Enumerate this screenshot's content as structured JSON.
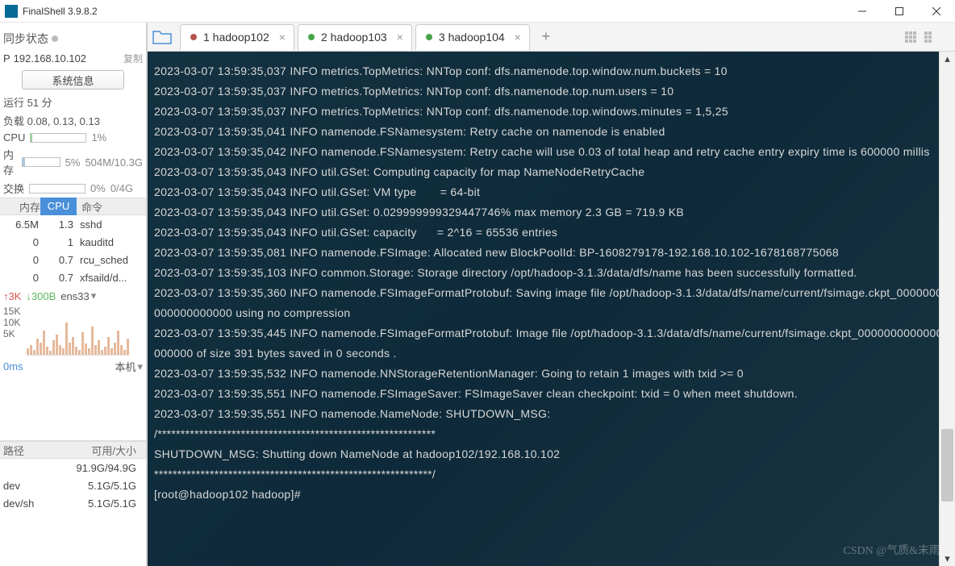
{
  "title": "FinalShell 3.9.8.2",
  "sidebar": {
    "sync_label": "同步状态",
    "ip_prefix": "P",
    "ip": "192.168.10.102",
    "copy": "复制",
    "sysinfo_btn": "系统信息",
    "uptime": "运行 51 分",
    "load": "负载 0.08, 0.13, 0.13",
    "cpu_label": "CPU",
    "cpu_val": "1%",
    "mem_label": "内存",
    "mem_pct": "5%",
    "mem_val": "504M/10.3G",
    "swap_label": "交换",
    "swap_pct": "0%",
    "swap_val": "0/4G",
    "proc_head": {
      "mem": "内存",
      "cpu": "CPU",
      "cmd": "命令"
    },
    "procs": [
      {
        "mem": "6.5M",
        "cpu": "1.3",
        "cmd": "sshd"
      },
      {
        "mem": "0",
        "cpu": "1",
        "cmd": "kauditd"
      },
      {
        "mem": "0",
        "cpu": "0.7",
        "cmd": "rcu_sched"
      },
      {
        "mem": "0",
        "cpu": "0.7",
        "cmd": "xfsaild/d..."
      }
    ],
    "net_up": "↑3K",
    "net_down": "↓300B",
    "net_if": "ens33",
    "net_labels": [
      "15K",
      "10K",
      "5K"
    ],
    "host_left": "0ms",
    "host_right": "本机",
    "disk_head": {
      "path": "路径",
      "size": "可用/大小"
    },
    "disks": [
      {
        "path": "",
        "size": "91.9G/94.9G"
      },
      {
        "path": "dev",
        "size": "5.1G/5.1G"
      },
      {
        "path": "dev/sh",
        "size": "5.1G/5.1G"
      }
    ]
  },
  "tabs": [
    {
      "label": "1 hadoop102",
      "active": true,
      "dot": "red"
    },
    {
      "label": "2 hadoop103",
      "active": false,
      "dot": "green"
    },
    {
      "label": "3 hadoop104",
      "active": false,
      "dot": "green"
    }
  ],
  "terminal": [
    "2023-03-07 13:59:35,037 INFO metrics.TopMetrics: NNTop conf: dfs.namenode.top.window.num.buckets = 10",
    "2023-03-07 13:59:35,037 INFO metrics.TopMetrics: NNTop conf: dfs.namenode.top.num.users = 10",
    "2023-03-07 13:59:35,037 INFO metrics.TopMetrics: NNTop conf: dfs.namenode.top.windows.minutes = 1,5,25",
    "2023-03-07 13:59:35,041 INFO namenode.FSNamesystem: Retry cache on namenode is enabled",
    "2023-03-07 13:59:35,042 INFO namenode.FSNamesystem: Retry cache will use 0.03 of total heap and retry cache entry expiry time is 600000 millis",
    "2023-03-07 13:59:35,043 INFO util.GSet: Computing capacity for map NameNodeRetryCache",
    "2023-03-07 13:59:35,043 INFO util.GSet: VM type       = 64-bit",
    "2023-03-07 13:59:35,043 INFO util.GSet: 0.029999999329447746% max memory 2.3 GB = 719.9 KB",
    "2023-03-07 13:59:35,043 INFO util.GSet: capacity      = 2^16 = 65536 entries",
    "2023-03-07 13:59:35,081 INFO namenode.FSImage: Allocated new BlockPoolId: BP-1608279178-192.168.10.102-1678168775068",
    "2023-03-07 13:59:35,103 INFO common.Storage: Storage directory /opt/hadoop-3.1.3/data/dfs/name has been successfully formatted.",
    "2023-03-07 13:59:35,360 INFO namenode.FSImageFormatProtobuf: Saving image file /opt/hadoop-3.1.3/data/dfs/name/current/fsimage.ckpt_0000000000000000000 using no compression",
    "2023-03-07 13:59:35,445 INFO namenode.FSImageFormatProtobuf: Image file /opt/hadoop-3.1.3/data/dfs/name/current/fsimage.ckpt_0000000000000000000 of size 391 bytes saved in 0 seconds .",
    "2023-03-07 13:59:35,532 INFO namenode.NNStorageRetentionManager: Going to retain 1 images with txid >= 0",
    "2023-03-07 13:59:35,551 INFO namenode.FSImageSaver: FSImageSaver clean checkpoint: txid = 0 when meet shutdown.",
    "2023-03-07 13:59:35,551 INFO namenode.NameNode: SHUTDOWN_MSG:",
    "/************************************************************",
    "SHUTDOWN_MSG: Shutting down NameNode at hadoop102/192.168.10.102",
    "************************************************************/",
    "[root@hadoop102 hadoop]#"
  ],
  "watermark": "CSDN @气质&末雨"
}
